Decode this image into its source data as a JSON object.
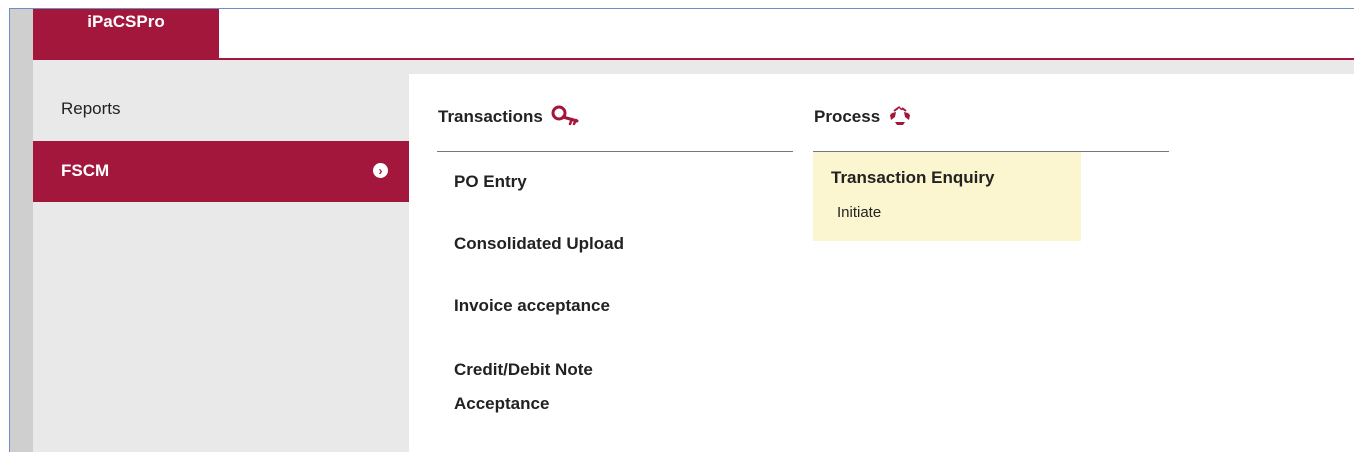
{
  "header": {
    "brand": "iPaCSPro"
  },
  "sidebar": {
    "items": [
      {
        "label": "Reports"
      },
      {
        "label": "FSCM"
      }
    ],
    "active_chevron": "›"
  },
  "transactions": {
    "title": "Transactions",
    "icon": "key-search-icon",
    "items": [
      {
        "label": "PO Entry"
      },
      {
        "label": "Consolidated Upload"
      },
      {
        "label": "Invoice acceptance"
      },
      {
        "label": "Credit/Debit Note"
      },
      {
        "label": "Acceptance"
      }
    ]
  },
  "process": {
    "title": "Process",
    "icon": "recycle-icon",
    "items": [
      {
        "label": "Transaction Enquiry",
        "sub": "Initiate"
      }
    ]
  },
  "colors": {
    "brand": "#a3173c",
    "sidebar_bg": "#e9e9ea",
    "process_highlight": "#fbf6cf"
  }
}
